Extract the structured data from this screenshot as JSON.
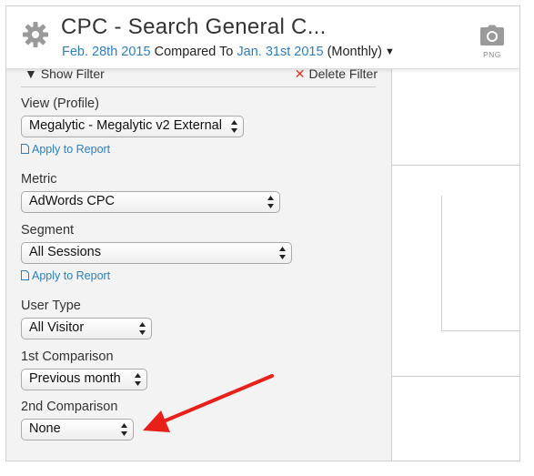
{
  "header": {
    "title": "CPC - Search General C...",
    "date_from": "Feb. 28th 2015",
    "compared_to": "Compared To",
    "date_to": "Jan. 31st 2015",
    "period": "(Monthly)",
    "png_label": "PNG"
  },
  "filter_bar": {
    "show_filter": "Show Filter",
    "delete_filter": "Delete Filter"
  },
  "form": {
    "view_label": "View (Profile)",
    "view_value": "Megalytic - Megalytic v2 External",
    "apply_to_report_1": "Apply to Report",
    "metric_label": "Metric",
    "metric_value": "AdWords CPC",
    "segment_label": "Segment",
    "segment_value": "All Sessions",
    "apply_to_report_2": "Apply to Report",
    "user_type_label": "User Type",
    "user_type_value": "All Visitor",
    "first_comparison_label": "1st Comparison",
    "first_comparison_value": "Previous month",
    "second_comparison_label": "2nd Comparison",
    "second_comparison_value": "None"
  },
  "colors": {
    "link_blue": "#2b7fc0",
    "annotation_red": "#e8201a",
    "delete_red": "#d9342b"
  },
  "icons": {
    "settings": "gear-icon",
    "export": "camera-icon",
    "document": "document-icon"
  }
}
